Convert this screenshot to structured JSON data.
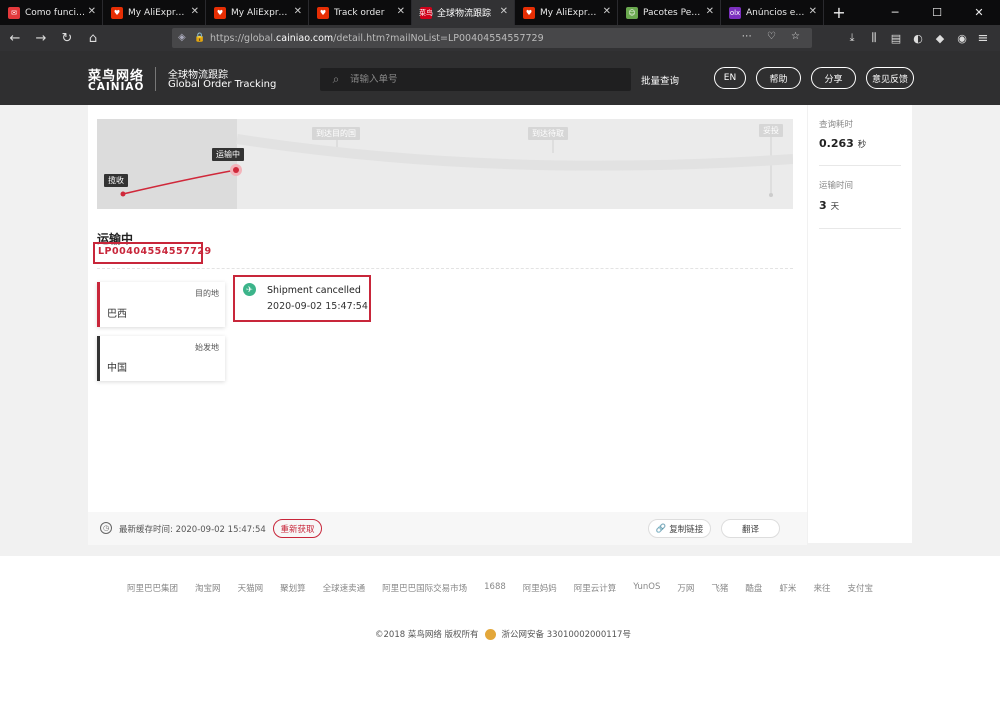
{
  "browser": {
    "tabs": [
      {
        "label": "Como funciona",
        "color": "#e4393c",
        "glyph": "✉",
        "active": false
      },
      {
        "label": "My AliExpress : N",
        "color": "#e62e04",
        "glyph": "♥",
        "active": false
      },
      {
        "label": "My AliExpress : N",
        "color": "#e62e04",
        "glyph": "♥",
        "active": false
      },
      {
        "label": "Track order",
        "color": "#e62e04",
        "glyph": "♥",
        "active": false
      },
      {
        "label": "全球物流跟踪",
        "color": "#d0021b",
        "glyph": "菜鸟",
        "active": true
      },
      {
        "label": "My AliExpress : N",
        "color": "#e62e04",
        "glyph": "♥",
        "active": false
      },
      {
        "label": "Pacotes Pendent",
        "color": "#6aa84f",
        "glyph": "☺",
        "active": false
      },
      {
        "label": "Anúncios em Bo",
        "color": "#7b2fbe",
        "glyph": "olx",
        "active": false
      }
    ],
    "url_prefix": "https://global.",
    "url_domain": "cainiao.com",
    "url_suffix": "/detail.htm?mailNoList=LP00404554557729"
  },
  "header": {
    "logo_cn": "菜鸟网络",
    "logo_en": "CAINIAO",
    "subtitle_cn": "全球物流跟踪",
    "subtitle_en": "Global Order Tracking",
    "search_placeholder": "请输入单号",
    "batch_query": "批量查询",
    "btn_en": "EN",
    "btn_help": "帮助",
    "btn_share": "分享",
    "btn_feedback": "意见反馈"
  },
  "map": {
    "stages": [
      "揽收",
      "运输中",
      "到达目的国",
      "到达待取",
      "妥投"
    ]
  },
  "shipment": {
    "status": "运输中",
    "tracking_number": "LP00404554557729",
    "destination_label": "目的地",
    "destination": "巴西",
    "origin_label": "始发地",
    "origin": "中国",
    "event": "Shipment cancelled",
    "event_time": "2020-09-02 15:47:54"
  },
  "card_footer": {
    "cache_time": "最新缓存时间: 2020-09-02 15:47:54",
    "refresh": "重新获取",
    "copy_link": "复制链接",
    "translate": "翻译"
  },
  "side": {
    "query_time_label": "查询耗时",
    "query_time_value": "0.263",
    "query_time_unit": "秒",
    "transit_label": "运输时间",
    "transit_value": "3",
    "transit_unit": "天"
  },
  "footer": {
    "links": [
      "阿里巴巴集团",
      "淘宝网",
      "天猫网",
      "聚划算",
      "全球速卖通",
      "阿里巴巴国际交易市场",
      "1688",
      "阿里妈妈",
      "阿里云计算",
      "YunOS",
      "万网",
      "飞猪",
      "酷盘",
      "虾米",
      "来往",
      "支付宝"
    ],
    "copyright": "©2018 菜鸟网络 版权所有",
    "icp": "浙公网安备 33010002000117号"
  },
  "colors": {
    "accent": "#c8263a",
    "header_bg": "#2f2f30",
    "event_icon": "#3cb48a"
  }
}
